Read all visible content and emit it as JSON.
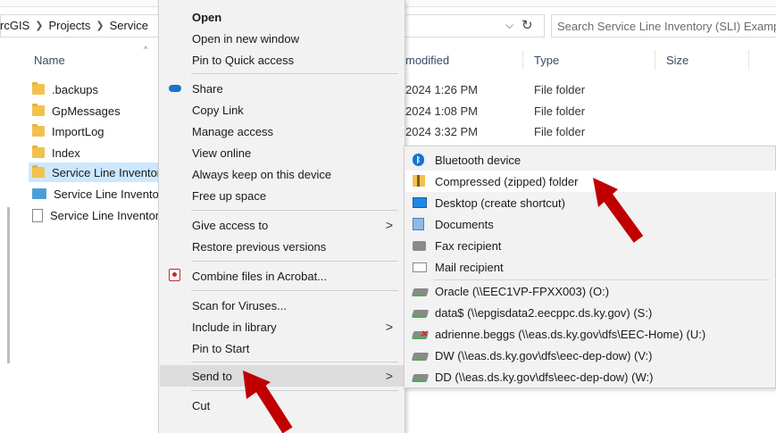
{
  "explorer": {
    "breadcrumbs": [
      "rcGIS",
      "Projects",
      "Service"
    ],
    "search_placeholder": "Search Service Line Inventory (SLI) Exampl",
    "columns": {
      "name": "Name",
      "modified": "modified",
      "type": "Type",
      "size": "Size"
    },
    "files": [
      {
        "name": ".backups",
        "icon": "folder-icon",
        "modified": "2024 1:26 PM",
        "type": "File folder"
      },
      {
        "name": "GpMessages",
        "icon": "folder-icon",
        "modified": "2024 1:08 PM",
        "type": "File folder"
      },
      {
        "name": "ImportLog",
        "icon": "folder-icon",
        "modified": "2024 3:32 PM",
        "type": "File folder"
      },
      {
        "name": "Index",
        "icon": "folder-icon",
        "modified": "",
        "type": ""
      },
      {
        "name": "Service Line Inventor",
        "icon": "folder-icon",
        "selected": true
      },
      {
        "name": "Service Line Inventor",
        "icon": "picture-folder-icon"
      },
      {
        "name": "Service Line Inventor",
        "icon": "document-icon"
      }
    ]
  },
  "context_menu": {
    "items": [
      {
        "label": "Open",
        "bold": true
      },
      {
        "label": "Open in new window"
      },
      {
        "label": "Pin to Quick access"
      },
      {
        "label": "Share",
        "icon": "onedrive-cloud-icon"
      },
      {
        "label": "Copy Link"
      },
      {
        "label": "Manage access"
      },
      {
        "label": "View online"
      },
      {
        "label": "Always keep on this device"
      },
      {
        "label": "Free up space"
      },
      {
        "label": "Give access to",
        "submenu": true
      },
      {
        "label": "Restore previous versions"
      },
      {
        "label": "Combine files in Acrobat...",
        "icon": "acrobat-icon"
      },
      {
        "label": "Scan for Viruses..."
      },
      {
        "label": "Include in library",
        "submenu": true
      },
      {
        "label": "Pin to Start"
      },
      {
        "label": "Send to",
        "submenu": true,
        "highlighted": true
      },
      {
        "label": "Cut"
      }
    ]
  },
  "send_to_menu": {
    "items": [
      {
        "label": "Bluetooth device",
        "icon": "bluetooth-icon"
      },
      {
        "label": "Compressed (zipped) folder",
        "icon": "zip-folder-icon",
        "hovered": true
      },
      {
        "label": "Desktop (create shortcut)",
        "icon": "desktop-icon"
      },
      {
        "label": "Documents",
        "icon": "documents-icon"
      },
      {
        "label": "Fax recipient",
        "icon": "fax-icon"
      },
      {
        "label": "Mail recipient",
        "icon": "mail-icon"
      },
      {
        "label": "Oracle (\\\\EEC1VP-FPXX003) (O:)",
        "icon": "network-drive-icon"
      },
      {
        "label": "data$ (\\\\epgisdata2.eecppc.ds.ky.gov) (S:)",
        "icon": "network-drive-icon"
      },
      {
        "label": "adrienne.beggs (\\\\eas.ds.ky.gov\\dfs\\EEC-Home) (U:)",
        "icon": "disconnected-drive-icon"
      },
      {
        "label": "DW (\\\\eas.ds.ky.gov\\dfs\\eec-dep-dow) (V:)",
        "icon": "network-drive-icon"
      },
      {
        "label": "DD (\\\\eas.ds.ky.gov\\dfs\\eec-dep-dow) (W:)",
        "icon": "network-drive-icon"
      }
    ]
  },
  "colors": {
    "arrow": "#c00000",
    "selection": "#cce8ff",
    "menu_background": "#f2f2f2",
    "menu_highlight": "#dcdcdc"
  }
}
